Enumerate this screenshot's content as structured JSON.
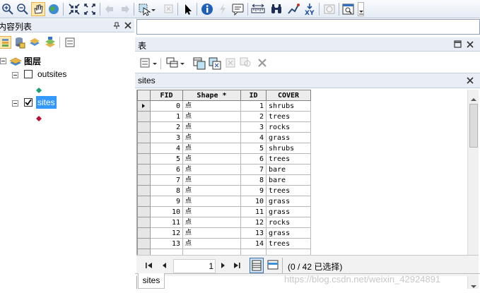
{
  "toc": {
    "title": "内容列表",
    "layers_label": "图层",
    "layers": [
      {
        "name": "outsites",
        "checked": false,
        "symbol_color": "#1a9e7a"
      },
      {
        "name": "sites",
        "checked": true,
        "selected": true,
        "symbol_color": "#b5123a"
      }
    ]
  },
  "table_window": {
    "title": "表",
    "tab_title": "sites",
    "columns": [
      "FID",
      "Shape *",
      "ID",
      "COVER"
    ],
    "rows": [
      {
        "fid": "0",
        "shape": "点",
        "id": "1",
        "cover": "shrubs",
        "current": true
      },
      {
        "fid": "1",
        "shape": "点",
        "id": "2",
        "cover": "trees"
      },
      {
        "fid": "2",
        "shape": "点",
        "id": "3",
        "cover": "rocks"
      },
      {
        "fid": "3",
        "shape": "点",
        "id": "4",
        "cover": "grass"
      },
      {
        "fid": "4",
        "shape": "点",
        "id": "5",
        "cover": "shrubs"
      },
      {
        "fid": "5",
        "shape": "点",
        "id": "6",
        "cover": "trees"
      },
      {
        "fid": "6",
        "shape": "点",
        "id": "7",
        "cover": "bare"
      },
      {
        "fid": "7",
        "shape": "点",
        "id": "8",
        "cover": "bare"
      },
      {
        "fid": "8",
        "shape": "点",
        "id": "9",
        "cover": "trees"
      },
      {
        "fid": "9",
        "shape": "点",
        "id": "10",
        "cover": "grass"
      },
      {
        "fid": "10",
        "shape": "点",
        "id": "11",
        "cover": "grass"
      },
      {
        "fid": "11",
        "shape": "点",
        "id": "12",
        "cover": "rocks"
      },
      {
        "fid": "12",
        "shape": "点",
        "id": "13",
        "cover": "grass"
      },
      {
        "fid": "13",
        "shape": "点",
        "id": "14",
        "cover": "trees"
      }
    ],
    "nav": {
      "current_record": "1",
      "selection_status": "(0 / 42 已选择)"
    },
    "bottom_tab": "sites"
  },
  "watermark": "https://blog.csdn.net/weixin_42924891",
  "colors": {
    "accent_selection": "#3399ff",
    "panel_title_bg": "#e9eef6"
  }
}
